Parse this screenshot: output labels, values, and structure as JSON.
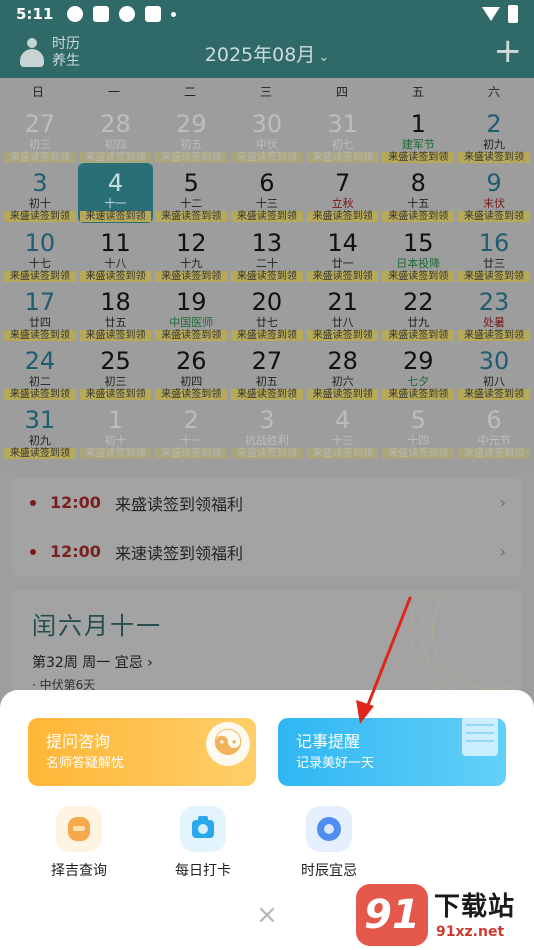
{
  "status_bar": {
    "time": "5:11"
  },
  "header": {
    "logo_line1": "时历",
    "logo_line2": "养生",
    "month": "2025年08月",
    "month_chevron": "⌄",
    "add_label": "+"
  },
  "weekdays": [
    "日",
    "一",
    "二",
    "三",
    "四",
    "五",
    "六"
  ],
  "calendar_days": [
    {
      "day": "27",
      "lunar": "初三",
      "tag": "来盛读签到领",
      "other": true
    },
    {
      "day": "28",
      "lunar": "初四",
      "tag": "来盛读签到领",
      "other": true
    },
    {
      "day": "29",
      "lunar": "初五",
      "tag": "来盛读签到领",
      "other": true
    },
    {
      "day": "30",
      "lunar": "中伏",
      "tag": "来盛读签到领",
      "other": true
    },
    {
      "day": "31",
      "lunar": "初七",
      "tag": "来盛读签到领",
      "other": true
    },
    {
      "day": "1",
      "lunar": "建军节",
      "tag": "来盛读签到领",
      "lunar_style": "fest"
    },
    {
      "day": "2",
      "lunar": "初九",
      "tag": "来盛读签到领"
    },
    {
      "day": "3",
      "lunar": "初十",
      "tag": "来盛读签到领"
    },
    {
      "day": "4",
      "lunar": "十一",
      "tag": "来速读签到领",
      "today": true
    },
    {
      "day": "5",
      "lunar": "十二",
      "tag": "来盛读签到领"
    },
    {
      "day": "6",
      "lunar": "十三",
      "tag": "来盛读签到领"
    },
    {
      "day": "7",
      "lunar": "立秋",
      "tag": "来盛读签到领",
      "lunar_style": "red"
    },
    {
      "day": "8",
      "lunar": "十五",
      "tag": "来盛读签到领"
    },
    {
      "day": "9",
      "lunar": "末伏",
      "tag": "来盛读签到领",
      "lunar_style": "red"
    },
    {
      "day": "10",
      "lunar": "十七",
      "tag": "来盛读签到领"
    },
    {
      "day": "11",
      "lunar": "十八",
      "tag": "来盛读签到领"
    },
    {
      "day": "12",
      "lunar": "十九",
      "tag": "来盛读签到领"
    },
    {
      "day": "13",
      "lunar": "二十",
      "tag": "来盛读签到领"
    },
    {
      "day": "14",
      "lunar": "廿一",
      "tag": "来盛读签到领"
    },
    {
      "day": "15",
      "lunar": "日本投降",
      "tag": "来盛读签到领",
      "lunar_style": "fest"
    },
    {
      "day": "16",
      "lunar": "廿三",
      "tag": "来盛读签到领"
    },
    {
      "day": "17",
      "lunar": "廿四",
      "tag": "来盛读签到领"
    },
    {
      "day": "18",
      "lunar": "廿五",
      "tag": "来盛读签到领"
    },
    {
      "day": "19",
      "lunar": "中国医师",
      "tag": "来盛读签到领",
      "lunar_style": "fest"
    },
    {
      "day": "20",
      "lunar": "廿七",
      "tag": "来盛读签到领"
    },
    {
      "day": "21",
      "lunar": "廿八",
      "tag": "来盛读签到领"
    },
    {
      "day": "22",
      "lunar": "廿九",
      "tag": "来盛读签到领"
    },
    {
      "day": "23",
      "lunar": "处暑",
      "tag": "来盛读签到领",
      "lunar_style": "red"
    },
    {
      "day": "24",
      "lunar": "初二",
      "tag": "来盛读签到领"
    },
    {
      "day": "25",
      "lunar": "初三",
      "tag": "来盛读签到领"
    },
    {
      "day": "26",
      "lunar": "初四",
      "tag": "来盛读签到领"
    },
    {
      "day": "27",
      "lunar": "初五",
      "tag": "来盛读签到领"
    },
    {
      "day": "28",
      "lunar": "初六",
      "tag": "来盛读签到领"
    },
    {
      "day": "29",
      "lunar": "七夕",
      "tag": "来盛读签到领",
      "lunar_style": "fest"
    },
    {
      "day": "30",
      "lunar": "初八",
      "tag": "来盛读签到领"
    },
    {
      "day": "31",
      "lunar": "初九",
      "tag": "来盛读签到领"
    },
    {
      "day": "1",
      "lunar": "初十",
      "tag": "来盛读签到领",
      "other": true
    },
    {
      "day": "2",
      "lunar": "十一",
      "tag": "来盛读签到领",
      "other": true
    },
    {
      "day": "3",
      "lunar": "抗战胜利",
      "tag": "来盛读签到领",
      "other": true
    },
    {
      "day": "4",
      "lunar": "十三",
      "tag": "来盛读签到领",
      "other": true
    },
    {
      "day": "5",
      "lunar": "十四",
      "tag": "来盛读签到领",
      "other": true
    },
    {
      "day": "6",
      "lunar": "中元节",
      "tag": "来盛读签到领",
      "other": true
    }
  ],
  "events": [
    {
      "time": "12:00",
      "title": "来盛读签到领福利",
      "arrow": "›"
    },
    {
      "time": "12:00",
      "title": "来速读签到领福利",
      "arrow": "›"
    }
  ],
  "info": {
    "lunar_date": "闰六月十一",
    "week_info": "第32周 周一 宜忌 ›",
    "season_info": "· 中伏第6天"
  },
  "sheet": {
    "promo_ask": {
      "title": "提问咨询",
      "subtitle": "名师答疑解忧"
    },
    "promo_memo": {
      "title": "记事提醒",
      "subtitle": "记录美好一天"
    },
    "quick": [
      {
        "label": "择吉查询",
        "icon": "lantern-icon"
      },
      {
        "label": "每日打卡",
        "icon": "camera-icon"
      },
      {
        "label": "时辰宜忌",
        "icon": "compass-icon"
      }
    ],
    "close_label": "×"
  },
  "watermark": {
    "mark": "91",
    "title": "下载站",
    "url": "91xz.net"
  },
  "colors": {
    "header_bg": "#2f6a69",
    "promo_ask": "#ffb636",
    "promo_memo": "#2fb6f2",
    "event_time": "#7a1f1f",
    "arrow": "#e0251b"
  }
}
